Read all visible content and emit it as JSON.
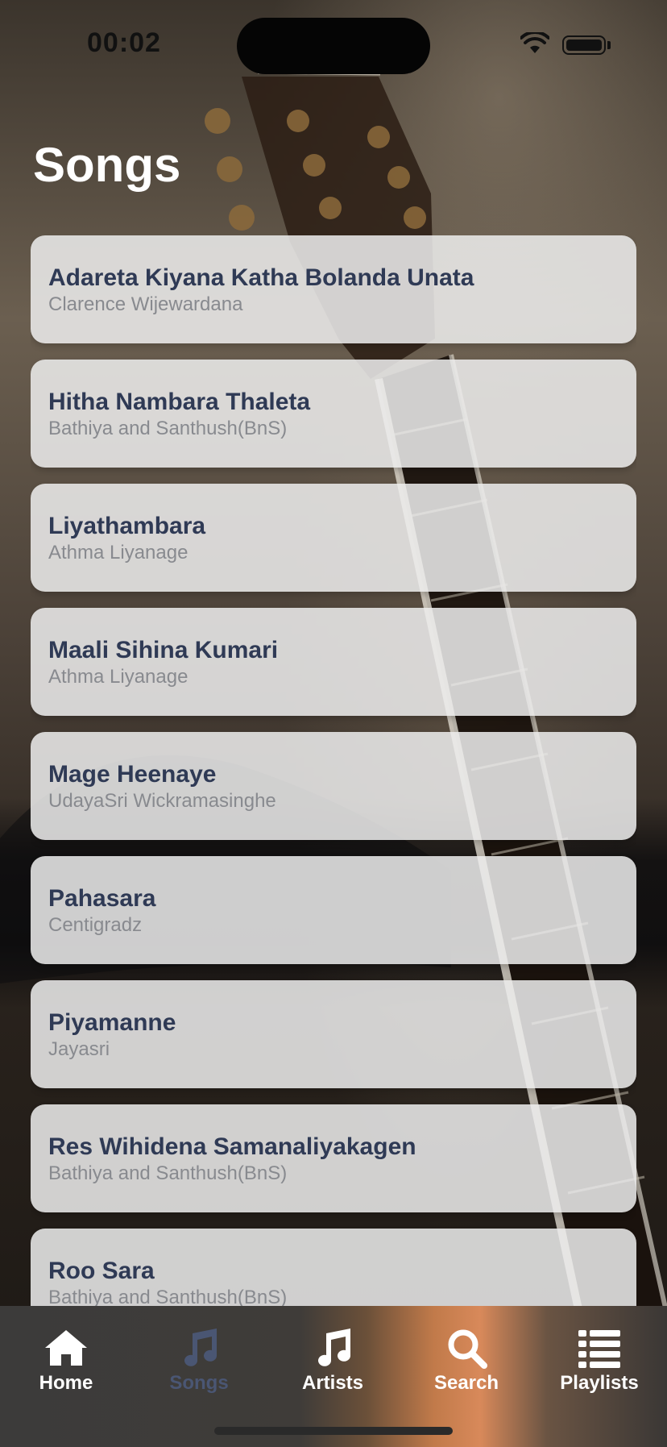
{
  "status_bar": {
    "time": "00:02"
  },
  "page": {
    "title": "Songs"
  },
  "songs": [
    {
      "title": "Adareta Kiyana Katha Bolanda Unata",
      "artist": "Clarence Wijewardana"
    },
    {
      "title": "Hitha Nambara Thaleta",
      "artist": "Bathiya and Santhush(BnS)"
    },
    {
      "title": "Liyathambara",
      "artist": "Athma Liyanage"
    },
    {
      "title": "Maali Sihina Kumari",
      "artist": "Athma Liyanage"
    },
    {
      "title": "Mage Heenaye",
      "artist": "UdayaSri Wickramasinghe"
    },
    {
      "title": "Pahasara",
      "artist": "Centigradz"
    },
    {
      "title": "Piyamanne",
      "artist": "Jayasri"
    },
    {
      "title": "Res Wihidena Samanaliyakagen",
      "artist": "Bathiya and Santhush(BnS)"
    },
    {
      "title": "Roo Sara",
      "artist": "Bathiya and Santhush(BnS)"
    }
  ],
  "tab_bar": {
    "active": "Songs",
    "tabs": [
      {
        "label": "Home",
        "icon": "house-icon"
      },
      {
        "label": "Songs",
        "icon": "music-note-icon"
      },
      {
        "label": "Artists",
        "icon": "music-note-icon"
      },
      {
        "label": "Search",
        "icon": "magnifying-glass-icon"
      },
      {
        "label": "Playlists",
        "icon": "list-icon"
      }
    ]
  },
  "colors": {
    "song_title": "#2f3a55",
    "song_artist": "#888a8f",
    "tab_active": "#4a5673",
    "tab_inactive": "#ffffff"
  }
}
